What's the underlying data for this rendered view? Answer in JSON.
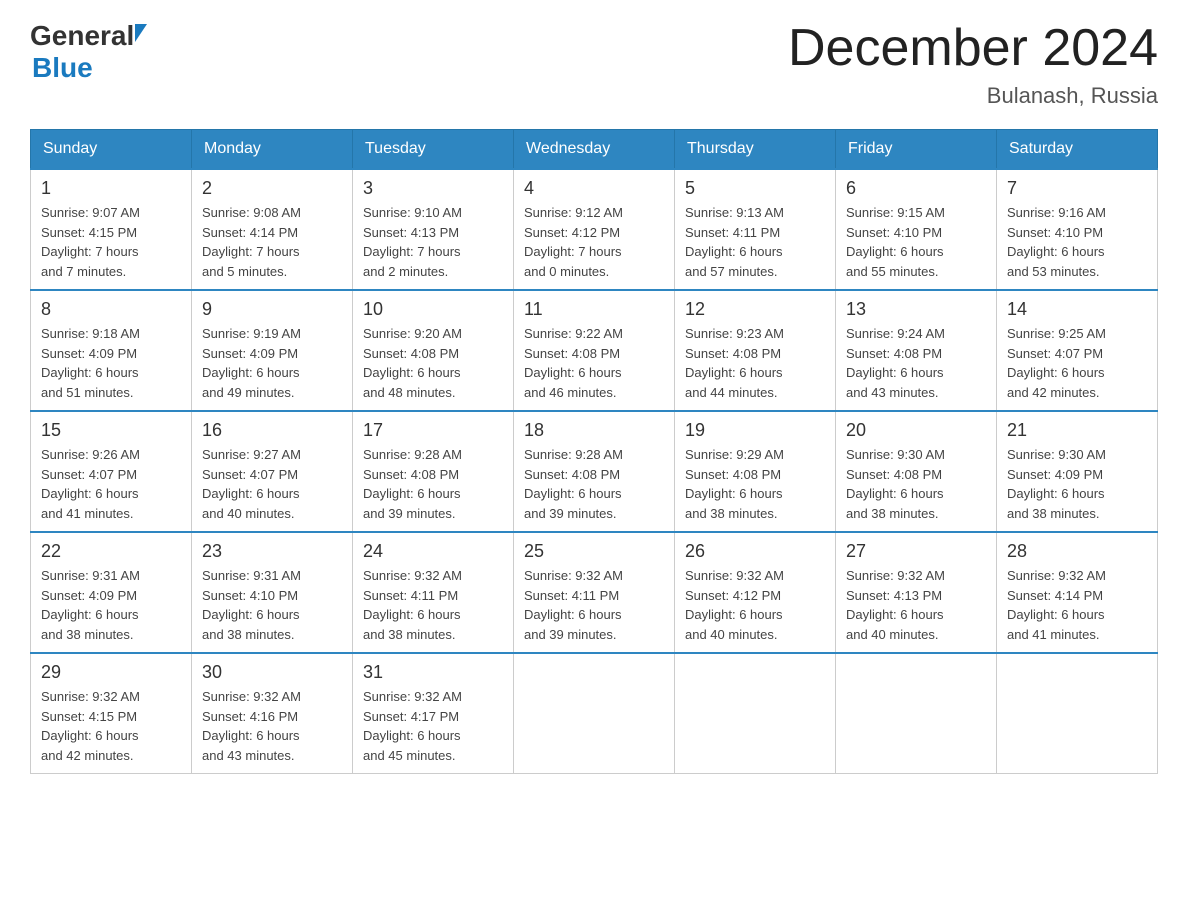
{
  "header": {
    "logo_general": "General",
    "logo_blue": "Blue",
    "main_title": "December 2024",
    "subtitle": "Bulanash, Russia"
  },
  "calendar": {
    "days_of_week": [
      "Sunday",
      "Monday",
      "Tuesday",
      "Wednesday",
      "Thursday",
      "Friday",
      "Saturday"
    ],
    "weeks": [
      [
        {
          "day": "1",
          "sunrise": "9:07 AM",
          "sunset": "4:15 PM",
          "daylight": "7 hours and 7 minutes."
        },
        {
          "day": "2",
          "sunrise": "9:08 AM",
          "sunset": "4:14 PM",
          "daylight": "7 hours and 5 minutes."
        },
        {
          "day": "3",
          "sunrise": "9:10 AM",
          "sunset": "4:13 PM",
          "daylight": "7 hours and 2 minutes."
        },
        {
          "day": "4",
          "sunrise": "9:12 AM",
          "sunset": "4:12 PM",
          "daylight": "7 hours and 0 minutes."
        },
        {
          "day": "5",
          "sunrise": "9:13 AM",
          "sunset": "4:11 PM",
          "daylight": "6 hours and 57 minutes."
        },
        {
          "day": "6",
          "sunrise": "9:15 AM",
          "sunset": "4:10 PM",
          "daylight": "6 hours and 55 minutes."
        },
        {
          "day": "7",
          "sunrise": "9:16 AM",
          "sunset": "4:10 PM",
          "daylight": "6 hours and 53 minutes."
        }
      ],
      [
        {
          "day": "8",
          "sunrise": "9:18 AM",
          "sunset": "4:09 PM",
          "daylight": "6 hours and 51 minutes."
        },
        {
          "day": "9",
          "sunrise": "9:19 AM",
          "sunset": "4:09 PM",
          "daylight": "6 hours and 49 minutes."
        },
        {
          "day": "10",
          "sunrise": "9:20 AM",
          "sunset": "4:08 PM",
          "daylight": "6 hours and 48 minutes."
        },
        {
          "day": "11",
          "sunrise": "9:22 AM",
          "sunset": "4:08 PM",
          "daylight": "6 hours and 46 minutes."
        },
        {
          "day": "12",
          "sunrise": "9:23 AM",
          "sunset": "4:08 PM",
          "daylight": "6 hours and 44 minutes."
        },
        {
          "day": "13",
          "sunrise": "9:24 AM",
          "sunset": "4:08 PM",
          "daylight": "6 hours and 43 minutes."
        },
        {
          "day": "14",
          "sunrise": "9:25 AM",
          "sunset": "4:07 PM",
          "daylight": "6 hours and 42 minutes."
        }
      ],
      [
        {
          "day": "15",
          "sunrise": "9:26 AM",
          "sunset": "4:07 PM",
          "daylight": "6 hours and 41 minutes."
        },
        {
          "day": "16",
          "sunrise": "9:27 AM",
          "sunset": "4:07 PM",
          "daylight": "6 hours and 40 minutes."
        },
        {
          "day": "17",
          "sunrise": "9:28 AM",
          "sunset": "4:08 PM",
          "daylight": "6 hours and 39 minutes."
        },
        {
          "day": "18",
          "sunrise": "9:28 AM",
          "sunset": "4:08 PM",
          "daylight": "6 hours and 39 minutes."
        },
        {
          "day": "19",
          "sunrise": "9:29 AM",
          "sunset": "4:08 PM",
          "daylight": "6 hours and 38 minutes."
        },
        {
          "day": "20",
          "sunrise": "9:30 AM",
          "sunset": "4:08 PM",
          "daylight": "6 hours and 38 minutes."
        },
        {
          "day": "21",
          "sunrise": "9:30 AM",
          "sunset": "4:09 PM",
          "daylight": "6 hours and 38 minutes."
        }
      ],
      [
        {
          "day": "22",
          "sunrise": "9:31 AM",
          "sunset": "4:09 PM",
          "daylight": "6 hours and 38 minutes."
        },
        {
          "day": "23",
          "sunrise": "9:31 AM",
          "sunset": "4:10 PM",
          "daylight": "6 hours and 38 minutes."
        },
        {
          "day": "24",
          "sunrise": "9:32 AM",
          "sunset": "4:11 PM",
          "daylight": "6 hours and 38 minutes."
        },
        {
          "day": "25",
          "sunrise": "9:32 AM",
          "sunset": "4:11 PM",
          "daylight": "6 hours and 39 minutes."
        },
        {
          "day": "26",
          "sunrise": "9:32 AM",
          "sunset": "4:12 PM",
          "daylight": "6 hours and 40 minutes."
        },
        {
          "day": "27",
          "sunrise": "9:32 AM",
          "sunset": "4:13 PM",
          "daylight": "6 hours and 40 minutes."
        },
        {
          "day": "28",
          "sunrise": "9:32 AM",
          "sunset": "4:14 PM",
          "daylight": "6 hours and 41 minutes."
        }
      ],
      [
        {
          "day": "29",
          "sunrise": "9:32 AM",
          "sunset": "4:15 PM",
          "daylight": "6 hours and 42 minutes."
        },
        {
          "day": "30",
          "sunrise": "9:32 AM",
          "sunset": "4:16 PM",
          "daylight": "6 hours and 43 minutes."
        },
        {
          "day": "31",
          "sunrise": "9:32 AM",
          "sunset": "4:17 PM",
          "daylight": "6 hours and 45 minutes."
        },
        null,
        null,
        null,
        null
      ]
    ]
  }
}
